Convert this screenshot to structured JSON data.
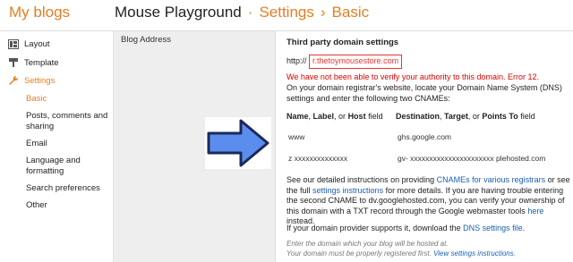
{
  "header": {
    "brand": "My blogs",
    "blog_name": "Mouse Playground",
    "sep1": "·",
    "section": "Settings",
    "sep2": "›",
    "current": "Basic"
  },
  "sidebar": {
    "items": [
      {
        "label": "Layout",
        "icon": "layout-icon"
      },
      {
        "label": "Template",
        "icon": "template-icon"
      },
      {
        "label": "Settings",
        "icon": "wrench-icon"
      }
    ],
    "subitems": [
      "Basic",
      "Posts, comments and sharing",
      "Email",
      "Language and formatting",
      "Search preferences",
      "Other"
    ]
  },
  "content": {
    "blog_address_label": "Blog Address",
    "panel": {
      "title": "Third party domain settings",
      "http_prefix": "http://",
      "domain_value": "r.thetoymousestore.com",
      "error": "We have not been able to verify your authority to this domain. Error 12.",
      "intro": "On your domain registrar's website, locate your Domain Name System (DNS) settings and enter the following two CNAMEs:",
      "table": {
        "col1_bold1": "Name",
        "col1_mid": ", ",
        "col1_bold2": "Label",
        "col1_mid2": ", or ",
        "col1_bold3": "Host",
        "col1_tail": " field",
        "col2_bold1": "Destination",
        "col2_mid": ", ",
        "col2_bold2": "Target",
        "col2_mid2": ", or ",
        "col2_bold3": "Points To",
        "col2_tail": " field",
        "rows": [
          {
            "name": "www",
            "dest": "ghs.google.com"
          },
          {
            "name": "z  xxxxxxxxxxxxxx",
            "dest": "gv- xxxxxxxxxxxxxxxxxxxxxx plehosted.com"
          }
        ]
      },
      "details_1": "See our detailed instructions on providing ",
      "link_cnames": "CNAMEs for various registrars",
      "details_2": " or see the full ",
      "link_settings": "settings instructions",
      "details_3": " for more details. If you are having trouble entering the second CNAME to dv.googlehosted.com, you can verify your ownership of this domain with a TXT record through the Google webmaster tools ",
      "link_here": "here",
      "details_4": " instead.",
      "supports_1": "If your domain provider supports it, download the ",
      "link_dns": "DNS settings file",
      "supports_2": ".",
      "hint1": "Enter the domain which your blog will be hosted at.",
      "hint2": "Your domain must be properly registered first. ",
      "hint_link": "View settings instructions",
      "hint_end": "."
    }
  },
  "colors": {
    "accent": "#e67e22",
    "arrow": "#5b8def",
    "error": "#dd0000",
    "link": "#1a5fb4"
  }
}
